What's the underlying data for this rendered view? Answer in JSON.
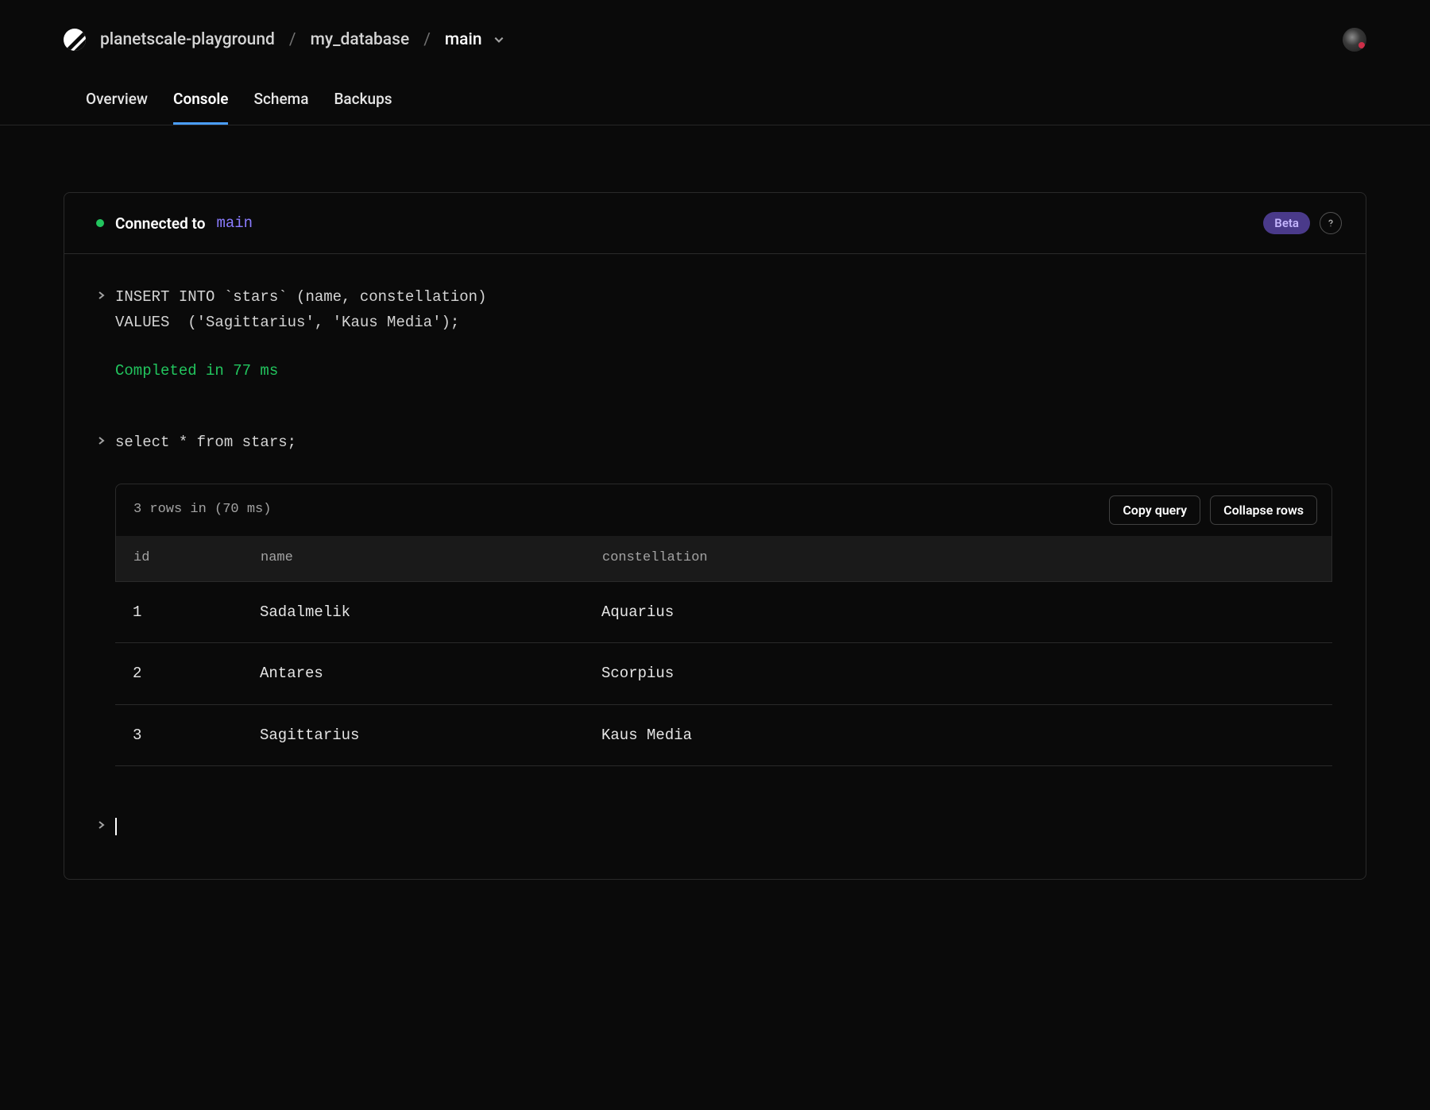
{
  "breadcrumb": {
    "org": "planetscale-playground",
    "database": "my_database",
    "branch": "main"
  },
  "tabs": [
    {
      "label": "Overview",
      "active": false
    },
    {
      "label": "Console",
      "active": true
    },
    {
      "label": "Schema",
      "active": false
    },
    {
      "label": "Backups",
      "active": false
    }
  ],
  "console": {
    "connected_label": "Connected to",
    "connected_branch": "main",
    "beta_badge": "Beta",
    "entries": [
      {
        "query": "INSERT INTO `stars` (name, constellation)\nVALUES  ('Sagittarius', 'Kaus Media');",
        "status": "Completed in 77 ms"
      },
      {
        "query": "select * from stars;",
        "result": {
          "meta": "3 rows in (70 ms)",
          "copy_label": "Copy query",
          "collapse_label": "Collapse rows",
          "columns": [
            "id",
            "name",
            "constellation"
          ],
          "rows": [
            {
              "id": "1",
              "name": "Sadalmelik",
              "constellation": "Aquarius"
            },
            {
              "id": "2",
              "name": "Antares",
              "constellation": "Scorpius"
            },
            {
              "id": "3",
              "name": "Sagittarius",
              "constellation": "Kaus Media"
            }
          ]
        }
      }
    ]
  }
}
